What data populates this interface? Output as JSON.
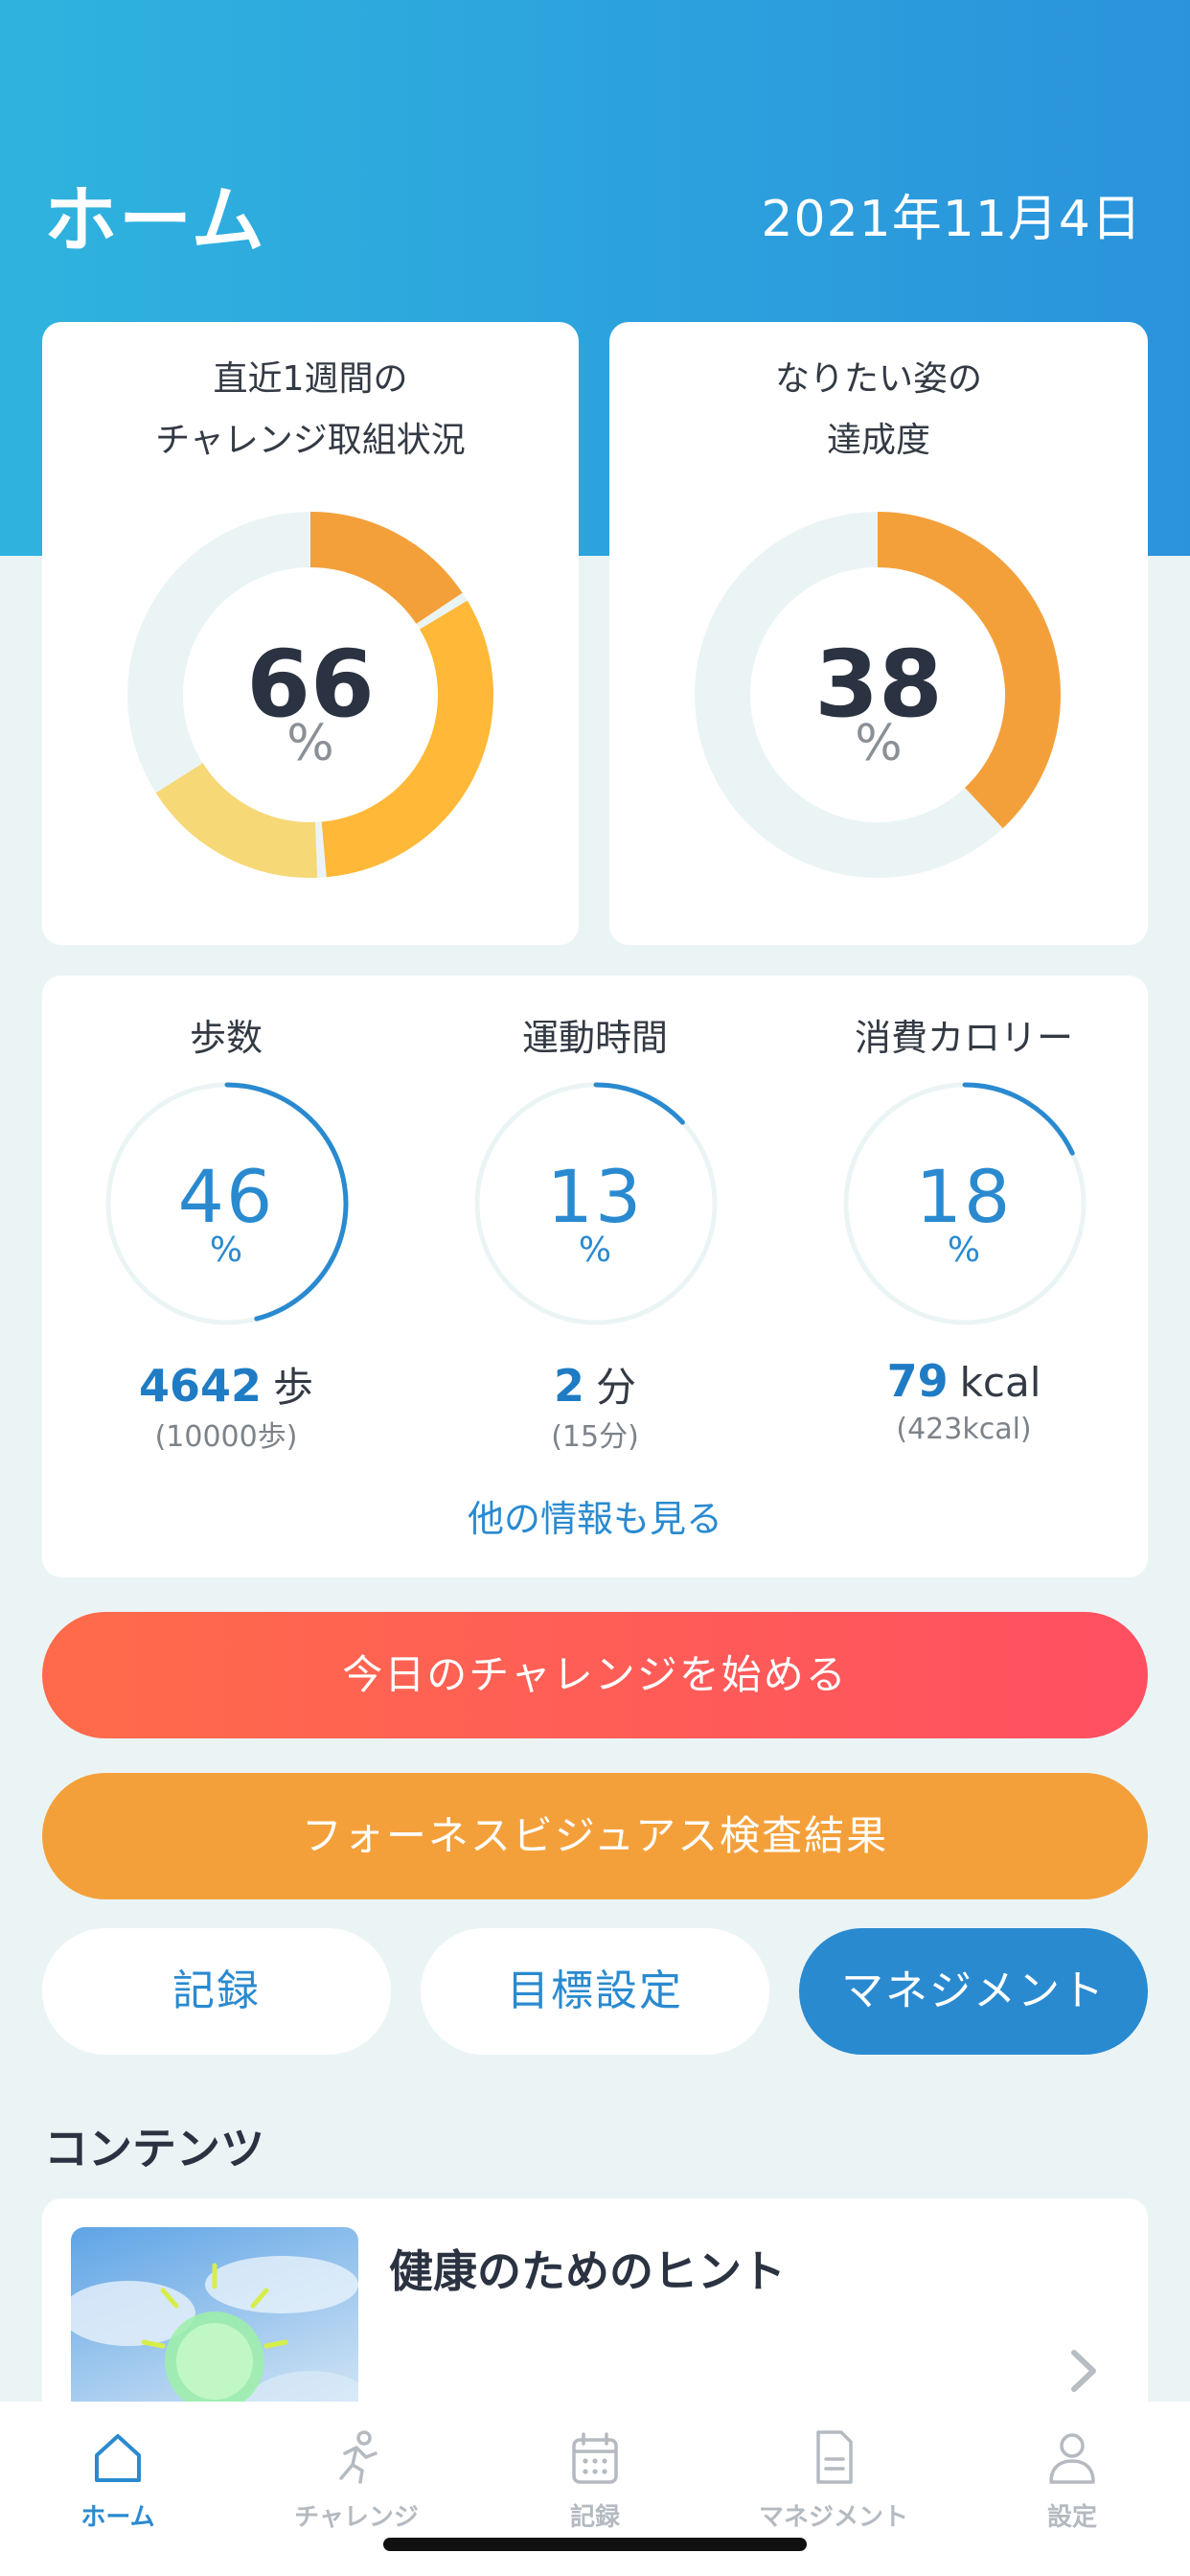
{
  "header": {
    "title": "ホーム",
    "date": "2021年11月4日"
  },
  "challenge_card": {
    "title_line1": "直近1週間の",
    "title_line2": "チャレンジ取組状況",
    "value": "66",
    "unit": "%",
    "percent": 66,
    "segment_colors": [
      "#f4a03a",
      "#ffb837",
      "#f6d877"
    ]
  },
  "goal_card": {
    "title_line1": "なりたい姿の",
    "title_line2": "達成度",
    "value": "38",
    "unit": "%",
    "percent": 38,
    "color": "#f4a03a"
  },
  "stats": [
    {
      "label": "歩数",
      "percent_text": "46",
      "percent": 46,
      "unit": "%",
      "amount": "4642",
      "amount_unit": "歩",
      "target": "(10000歩)"
    },
    {
      "label": "運動時間",
      "percent_text": "13",
      "percent": 13,
      "unit": "%",
      "amount": "2",
      "amount_unit": "分",
      "target": "(15分)"
    },
    {
      "label": "消費カロリー",
      "percent_text": "18",
      "percent": 18,
      "unit": "%",
      "amount": "79",
      "amount_unit": "kcal",
      "target": "(423kcal)"
    }
  ],
  "more_link": "他の情報も見る",
  "buttons": {
    "start_challenge": "今日のチャレンジを始める",
    "furness_result": "フォーネスビジュアス検査結果",
    "record": "記録",
    "goal_setting": "目標設定",
    "management": "マネジメント"
  },
  "contents": {
    "section_title": "コンテンツ",
    "items": [
      {
        "title": "健康のためのヒント",
        "thumbnail_icon": "lightbulb-icon"
      }
    ]
  },
  "tabbar": [
    {
      "label": "ホーム",
      "icon": "home-icon",
      "active": true
    },
    {
      "label": "チャレンジ",
      "icon": "running-icon",
      "active": false
    },
    {
      "label": "記録",
      "icon": "calendar-icon",
      "active": false
    },
    {
      "label": "マネジメント",
      "icon": "document-icon",
      "active": false
    },
    {
      "label": "設定",
      "icon": "person-icon",
      "active": false
    }
  ],
  "colors": {
    "primary_blue": "#2a8ad0",
    "orange": "#f4a03a",
    "coral": "#ff5d55",
    "track": "#ebf4f5"
  }
}
